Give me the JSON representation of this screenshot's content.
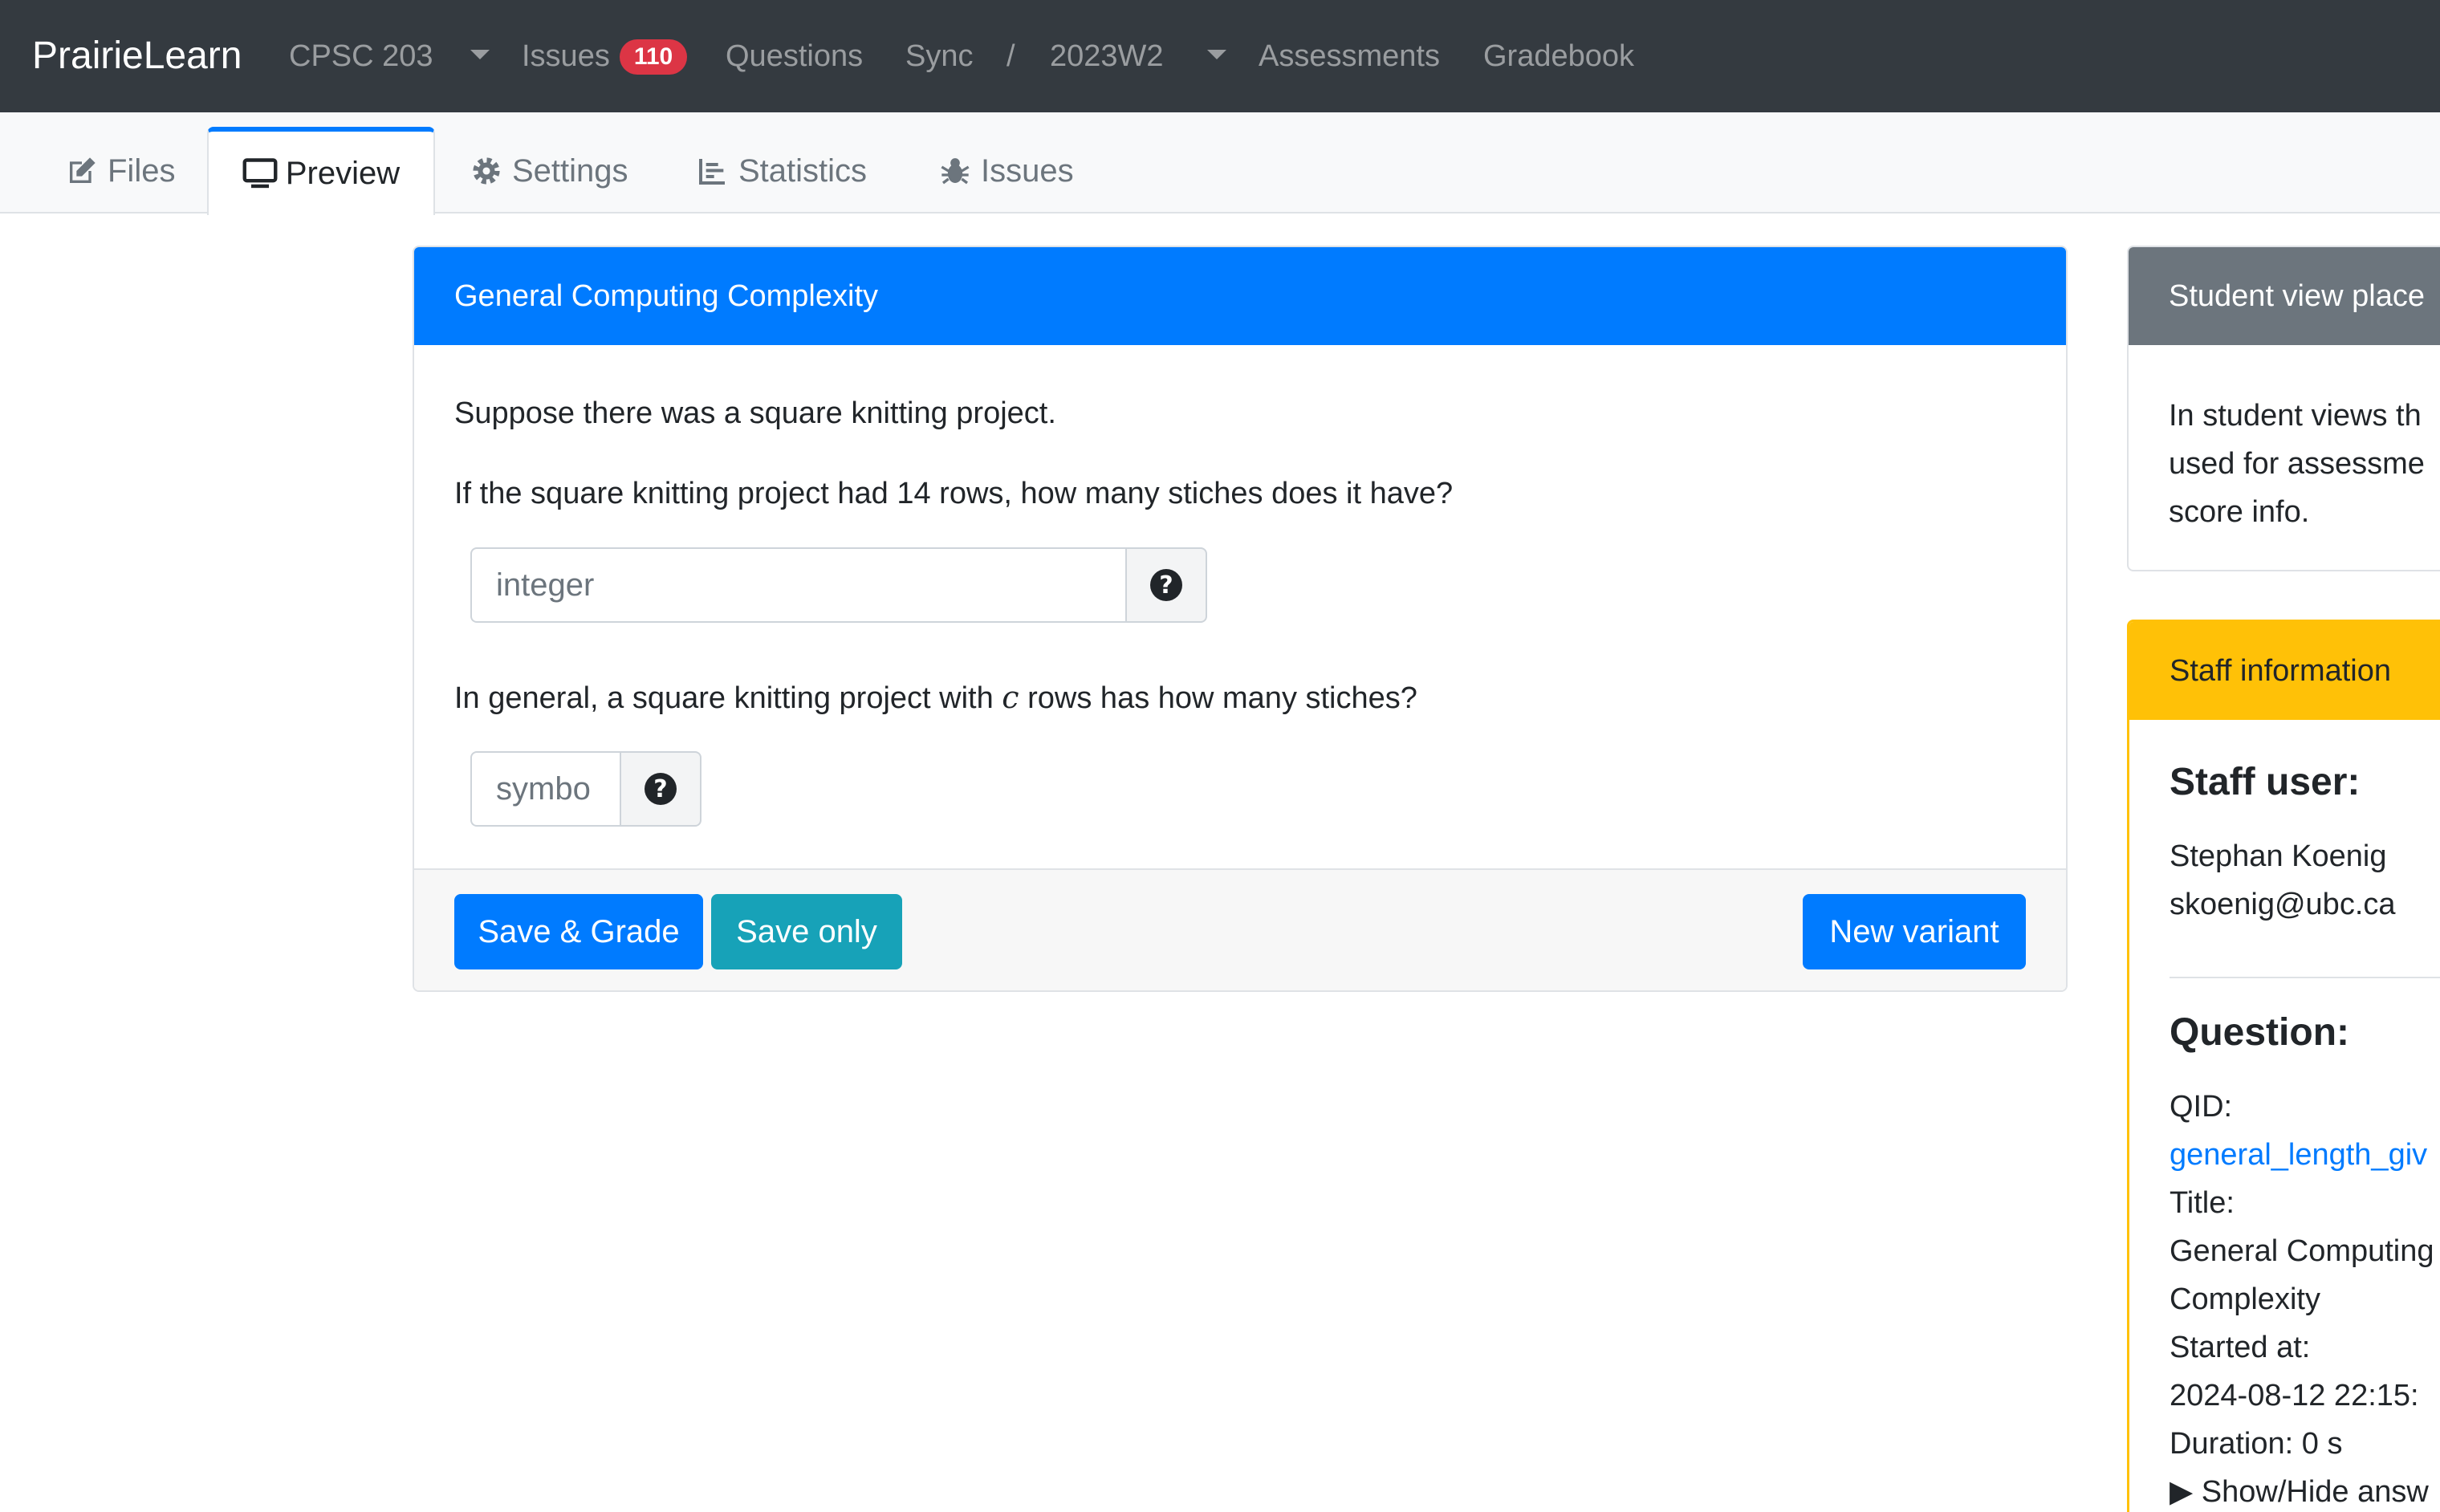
{
  "navbar": {
    "brand": "PrairieLearn",
    "course": "CPSC 203",
    "issues_label": "Issues",
    "issues_count": "110",
    "questions": "Questions",
    "sync": "Sync",
    "separator": "/",
    "term": "2023W2",
    "assessments": "Assessments",
    "gradebook": "Gradebook"
  },
  "tabs": [
    {
      "label": "Files",
      "icon": "edit-icon"
    },
    {
      "label": "Preview",
      "icon": "monitor-icon"
    },
    {
      "label": "Settings",
      "icon": "gear-icon"
    },
    {
      "label": "Statistics",
      "icon": "bar-chart-icon"
    },
    {
      "label": "Issues",
      "icon": "bug-icon"
    }
  ],
  "question": {
    "title": "General Computing Complexity",
    "line1": "Suppose there was a square knitting project.",
    "line2": "If the square knitting project had 14 rows, how many stiches does it have?",
    "input1_placeholder": "integer",
    "line3_prefix": "In general, a square knitting project with",
    "line3_var": "c",
    "line3_suffix": "rows has how many stiches?",
    "input2_placeholder": "symbo",
    "help_glyph": "?"
  },
  "buttons": {
    "save_grade": "Save & Grade",
    "save_only": "Save only",
    "new_variant": "New variant"
  },
  "student_view": {
    "header": "Student view place",
    "lines": [
      "In student views th",
      "used for assessme",
      "score info."
    ]
  },
  "staff": {
    "header": "Staff information",
    "staff_user_heading": "Staff user:",
    "name": "Stephan Koenig",
    "email": "skoenig@ubc.ca",
    "question_heading": "Question:",
    "qid_label": "QID:",
    "qid_value": "general_length_giv",
    "title_label": "Title:",
    "title_value_1": "General Computing",
    "title_value_2": "Complexity",
    "started_label": "Started at:",
    "started_value": "2024-08-12 22:15:",
    "duration": "Duration: 0 s",
    "toggle": "▶ Show/Hide answ"
  },
  "colors": {
    "navbar": "#343a40",
    "primary": "#007bff",
    "info": "#17a2b8",
    "danger": "#dc3545",
    "secondary": "#6c757d",
    "warning": "#ffc107"
  }
}
